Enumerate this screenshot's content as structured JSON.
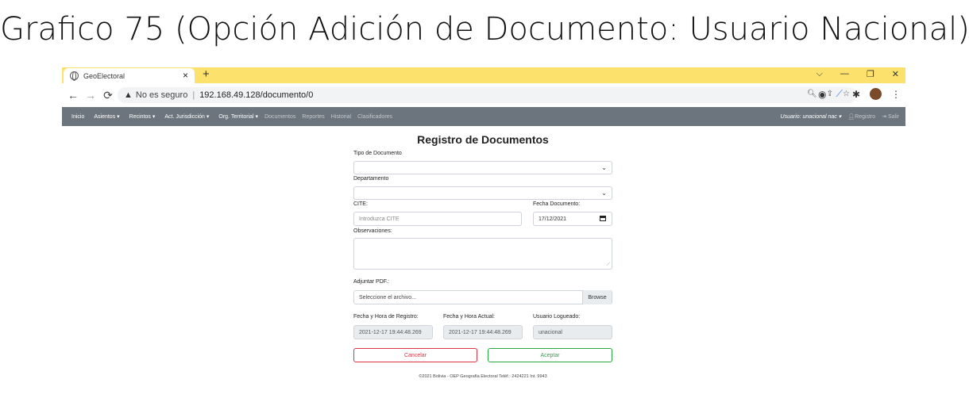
{
  "slide": {
    "title": "Grafico 75 (Opción Adición de Documento: Usuario Nacional)"
  },
  "browser": {
    "tab_title": "GeoElectoral",
    "tab_close": "×",
    "new_tab": "+",
    "window_controls": [
      "⌵",
      "—",
      "❐",
      "✕"
    ],
    "security_label": "No es seguro",
    "url": "192.168.49.128/documento/0"
  },
  "navbar": {
    "items": [
      "Inicio",
      "Asientos ▾",
      "Recintos ▾",
      "Act. Jurisdicción ▾",
      "Org. Territorial ▾"
    ],
    "dim_items": [
      "Documentos",
      "Reportes",
      "Historial",
      "Clasificadores"
    ],
    "user": "Usuario: unacional nac ▾",
    "registro": "Registro",
    "salir": "Salir"
  },
  "form": {
    "title": "Registro de Documentos",
    "tipo_label": "Tipo de Documento",
    "departamento_label": "Departamento",
    "cite_label": "CITE:",
    "cite_placeholder": "Introduzca CITE",
    "fecha_doc_label": "Fecha Documento:",
    "fecha_doc_value": "17/12/2021",
    "observaciones_label": "Observaciones:",
    "pdf_label": "Adjuntar PDF.:",
    "pdf_placeholder": "Seleccione el archivo...",
    "browse": "Browse",
    "fecha_registro_label": "Fecha y Hora de Registro:",
    "fecha_registro_value": "2021-12-17 19:44:48.269",
    "fecha_actual_label": "Fecha y Hora Actual:",
    "fecha_actual_value": "2021-12-17 19:44:48.269",
    "usuario_label": "Usuario Logueado:",
    "usuario_value": "unacional",
    "cancel": "Cancelar",
    "accept": "Aceptar"
  },
  "footer": "©2021 Bolivia - OEP Geografía Electoral Teléf.: 2424221 Int. 9943",
  "colors": {
    "tabbar": "#fde16d",
    "navbar": "#6c757d",
    "cancel": "#dc3545",
    "accept": "#28a745"
  }
}
